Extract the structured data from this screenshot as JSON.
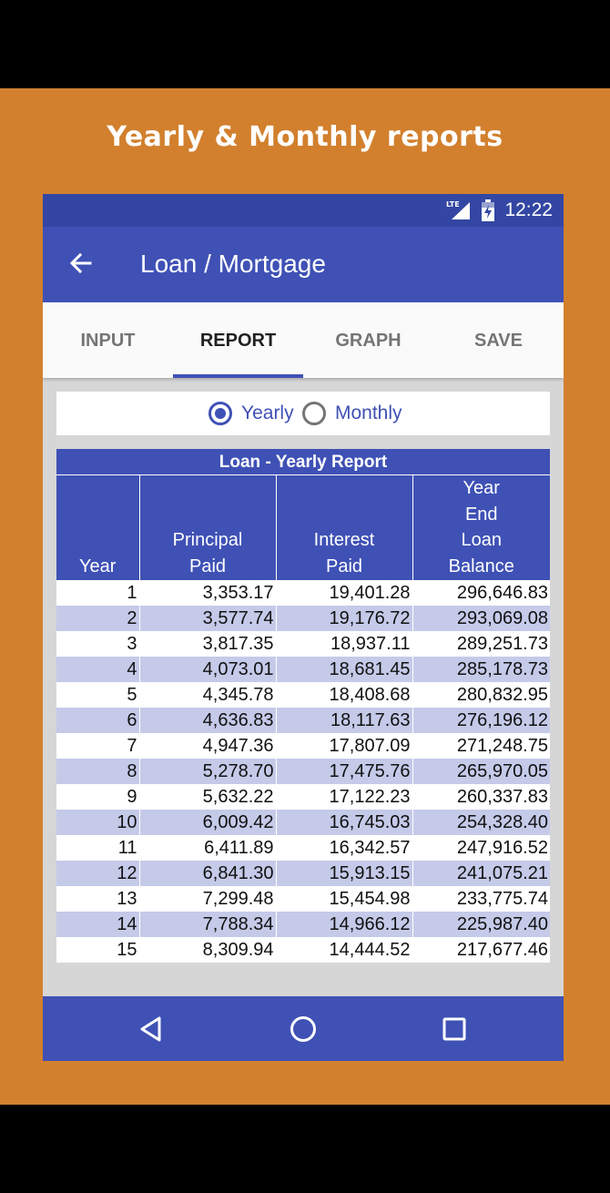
{
  "promo": {
    "title": "Yearly & Monthly reports"
  },
  "status_bar": {
    "time": "12:22",
    "network_label": "LTE"
  },
  "app_bar": {
    "title": "Loan / Mortgage"
  },
  "tabs": [
    {
      "label": "INPUT",
      "active": false
    },
    {
      "label": "REPORT",
      "active": true
    },
    {
      "label": "GRAPH",
      "active": false
    },
    {
      "label": "SAVE",
      "active": false
    }
  ],
  "radio": {
    "options": [
      {
        "label": "Yearly",
        "checked": true
      },
      {
        "label": "Monthly",
        "checked": false
      }
    ]
  },
  "report": {
    "title": "Loan - Yearly Report",
    "columns": [
      [
        "Year"
      ],
      [
        "Principal",
        "Paid"
      ],
      [
        "Interest",
        "Paid"
      ],
      [
        "Year",
        "End",
        "Loan",
        "Balance"
      ]
    ],
    "rows": [
      [
        "1",
        "3,353.17",
        "19,401.28",
        "296,646.83"
      ],
      [
        "2",
        "3,577.74",
        "19,176.72",
        "293,069.08"
      ],
      [
        "3",
        "3,817.35",
        "18,937.11",
        "289,251.73"
      ],
      [
        "4",
        "4,073.01",
        "18,681.45",
        "285,178.73"
      ],
      [
        "5",
        "4,345.78",
        "18,408.68",
        "280,832.95"
      ],
      [
        "6",
        "4,636.83",
        "18,117.63",
        "276,196.12"
      ],
      [
        "7",
        "4,947.36",
        "17,807.09",
        "271,248.75"
      ],
      [
        "8",
        "5,278.70",
        "17,475.76",
        "265,970.05"
      ],
      [
        "9",
        "5,632.22",
        "17,122.23",
        "260,337.83"
      ],
      [
        "10",
        "6,009.42",
        "16,745.03",
        "254,328.40"
      ],
      [
        "11",
        "6,411.89",
        "16,342.57",
        "247,916.52"
      ],
      [
        "12",
        "6,841.30",
        "15,913.15",
        "241,075.21"
      ],
      [
        "13",
        "7,299.48",
        "15,454.98",
        "233,775.74"
      ],
      [
        "14",
        "7,788.34",
        "14,966.12",
        "225,987.40"
      ],
      [
        "15",
        "8,309.94",
        "14,444.52",
        "217,677.46"
      ]
    ]
  },
  "colors": {
    "primary": "#3f51b5",
    "primary_dark": "#3346a3",
    "row_alt": "#c5cae9",
    "promo_bg": "#d2802e"
  },
  "icons": {
    "back": "arrow-left-icon",
    "nav_back": "triangle-back-icon",
    "nav_home": "circle-home-icon",
    "nav_recents": "square-recents-icon",
    "signal": "lte-signal-icon",
    "battery": "battery-icon"
  }
}
